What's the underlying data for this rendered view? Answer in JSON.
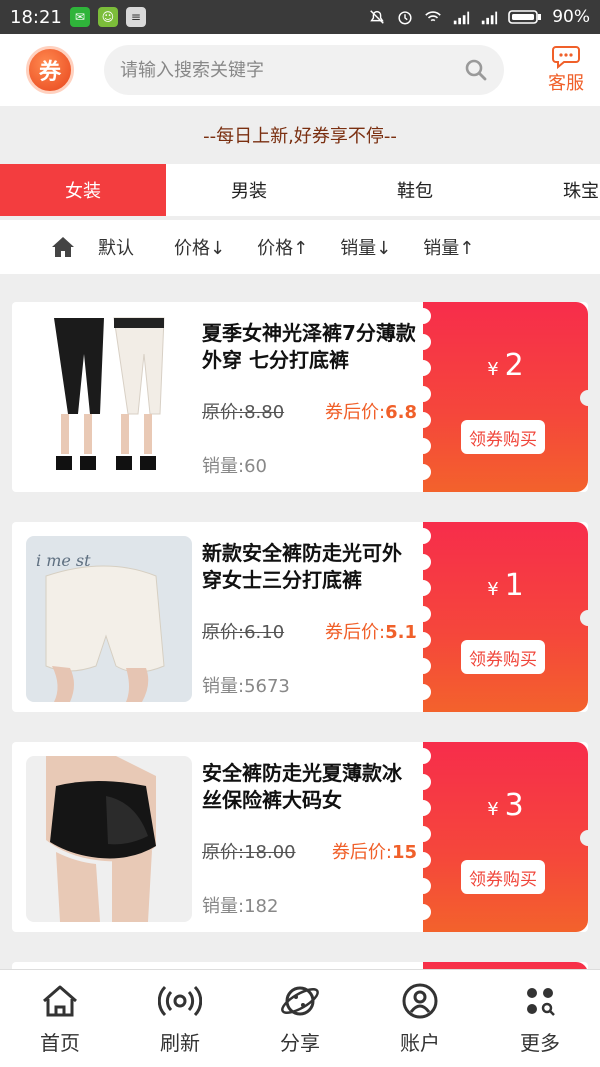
{
  "status": {
    "time": "18:21",
    "battery": "90%"
  },
  "header": {
    "logo_text": "券",
    "search_placeholder": "请输入搜索关键字",
    "service_label": "客服"
  },
  "slogan": "--每日上新,好券享不停--",
  "categories": [
    {
      "label": "女装"
    },
    {
      "label": "男装"
    },
    {
      "label": "鞋包"
    },
    {
      "label": "珠宝"
    }
  ],
  "sort": {
    "default": "默认",
    "price_desc": "价格↓",
    "price_asc": "价格↑",
    "sales_desc": "销量↓",
    "sales_asc": "销量↑"
  },
  "products": [
    {
      "title": "夏季女神光泽裤7分薄款外穿 七分打底裤",
      "original_price": "原价:8.80",
      "after_label": "券后价:",
      "after_price": "6.8",
      "sales": "销量:60",
      "coupon_symbol": "¥",
      "coupon_value": "2",
      "coupon_button": "领券购买"
    },
    {
      "title": "新款安全裤防走光可外穿女士三分打底裤",
      "original_price": "原价:6.10",
      "after_label": "券后价:",
      "after_price": "5.1",
      "sales": "销量:5673",
      "coupon_symbol": "¥",
      "coupon_value": "1",
      "coupon_button": "领券购买"
    },
    {
      "title": "安全裤防走光夏薄款冰丝保险裤大码女",
      "original_price": "原价:18.00",
      "after_label": "券后价:",
      "after_price": "15",
      "sales": "销量:182",
      "coupon_symbol": "¥",
      "coupon_value": "3",
      "coupon_button": "领券购买"
    }
  ],
  "bottom_nav": [
    {
      "label": "首页",
      "icon": "home-icon"
    },
    {
      "label": "刷新",
      "icon": "broadcast-icon"
    },
    {
      "label": "分享",
      "icon": "planet-icon"
    },
    {
      "label": "账户",
      "icon": "user-icon"
    },
    {
      "label": "更多",
      "icon": "more-icon"
    }
  ],
  "colors": {
    "accent": "#f33d3f",
    "coupon_top": "#f72d4b",
    "coupon_bottom": "#f3622c",
    "price_orange": "#f0602a"
  }
}
